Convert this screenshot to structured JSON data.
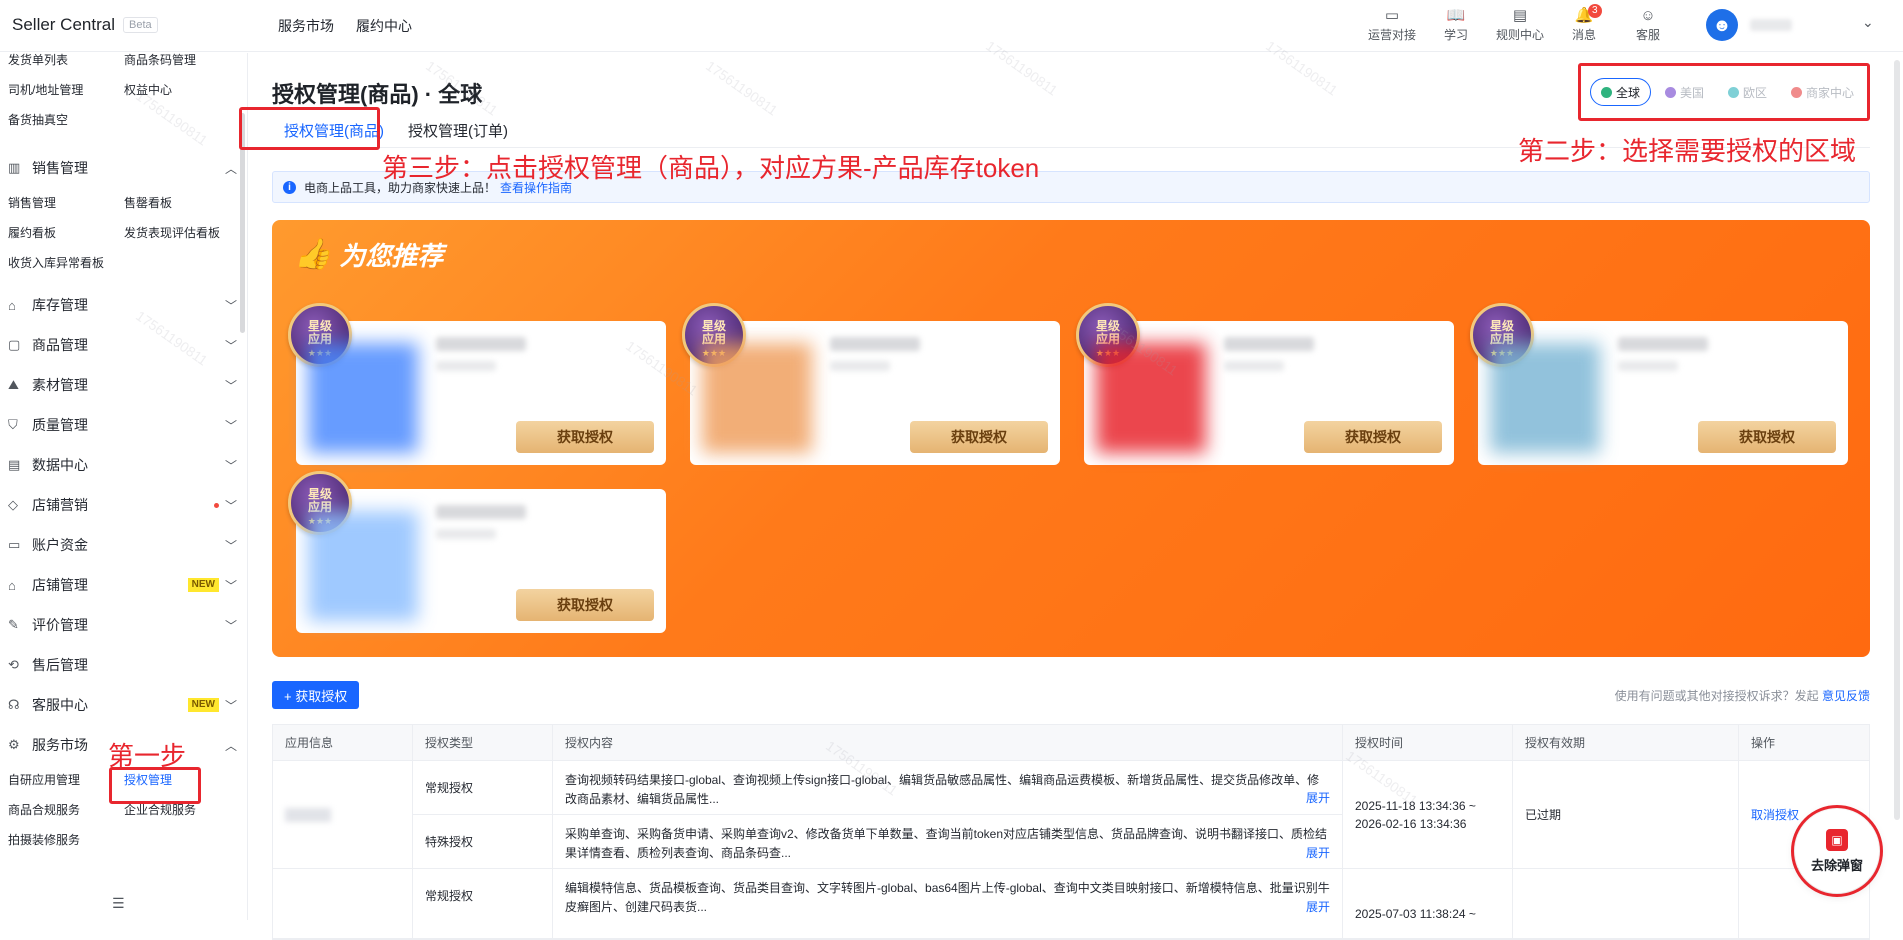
{
  "brand": {
    "name": "Seller Central",
    "beta": "Beta"
  },
  "top_nav": [
    "服务市场",
    "履约中心"
  ],
  "top_icons": [
    {
      "icon": "chat-icon",
      "label": "运营对接"
    },
    {
      "icon": "book-icon",
      "label": "学习"
    },
    {
      "icon": "doc-icon",
      "label": "规则中心"
    },
    {
      "icon": "bell-icon",
      "label": "消息",
      "badge": "3"
    },
    {
      "icon": "support-icon",
      "label": "客服"
    }
  ],
  "sidebar": {
    "top_items": [
      "发货单列表",
      "商品条码管理",
      "司机/地址管理",
      "权益中心",
      "备货抽真空"
    ],
    "sections": [
      {
        "label": "销售管理",
        "icon": "chart-icon",
        "expanded": true,
        "items": [
          "销售管理",
          "售罄看板",
          "履约看板",
          "发货表现评估看板",
          "收货入库异常看板"
        ]
      },
      {
        "label": "库存管理",
        "icon": "warehouse-icon"
      },
      {
        "label": "商品管理",
        "icon": "box-icon"
      },
      {
        "label": "素材管理",
        "icon": "image-icon"
      },
      {
        "label": "质量管理",
        "icon": "shield-icon"
      },
      {
        "label": "数据中心",
        "icon": "data-icon"
      },
      {
        "label": "店铺营销",
        "icon": "tag-icon",
        "dot": true
      },
      {
        "label": "账户资金",
        "icon": "wallet-icon"
      },
      {
        "label": "店铺管理",
        "icon": "store-icon",
        "new": "NEW"
      },
      {
        "label": "评价管理",
        "icon": "review-icon"
      },
      {
        "label": "售后管理",
        "icon": "aftersale-icon"
      },
      {
        "label": "客服中心",
        "icon": "headset-icon",
        "new": "NEW"
      },
      {
        "label": "服务市场",
        "icon": "market-icon",
        "expanded": true,
        "items": [
          "自研应用管理",
          "授权管理",
          "商品合规服务",
          "企业合规服务",
          "拍摄装修服务"
        ]
      }
    ]
  },
  "page": {
    "title": "授权管理(商品) · 全球",
    "tabs": [
      "授权管理(商品)",
      "授权管理(订单)"
    ],
    "regions": [
      {
        "label": "全球",
        "color": "#2fb37f",
        "active": true
      },
      {
        "label": "美国",
        "color": "#a88be0"
      },
      {
        "label": "欧区",
        "color": "#7fd0d6"
      },
      {
        "label": "商家中心",
        "color": "#f08b8b"
      }
    ],
    "info": {
      "text": "电商上品工具，助力商家快速上品！",
      "link": "查看操作指南"
    },
    "promo": {
      "title": "为您推荐",
      "medal_line1": "星级",
      "medal_line2": "应用",
      "button": "获取授权",
      "card_colors": [
        "#4d8bff",
        "#f0a060",
        "#e8262e",
        "#7fb8d6",
        "#8fc0ff"
      ]
    },
    "get_auth_button": "+ 获取授权",
    "feedback": {
      "text": "使用有问题或其他对接授权诉求？发起",
      "link": "意见反馈"
    },
    "table": {
      "headers": [
        "应用信息",
        "授权类型",
        "授权内容",
        "授权时间",
        "授权有效期",
        "操作"
      ],
      "rows": [
        {
          "types": [
            "常规授权",
            "特殊授权"
          ],
          "contents": [
            "查询视频转码结果接口-global、查询视频上传sign接口-global、编辑货品敏感品属性、编辑商品运费模板、新增货品属性、提交货品修改单、修改商品素材、编辑货品属性...",
            "采购单查询、采购备货申请、采购单查询v2、修改备货单下单数量、查询当前token对应店铺类型信息、货品品牌查询、说明书翻译接口、质检结果详情查看、质检列表查询、商品条码查..."
          ],
          "expand": "展开",
          "time": "2025-11-18 13:34:36 ~ 2026-02-16 13:34:36",
          "validity": "已过期",
          "action": "取消授权"
        },
        {
          "types": [
            "常规授权"
          ],
          "contents": [
            "编辑模特信息、货品模板查询、货品类目查询、文字转图片-global、bas64图片上传-global、查询中文类目映射接口、新增模特信息、批量识别牛皮癣图片、创建尺码表货..."
          ],
          "expand": "展开",
          "time": "2025-07-03 11:38:24 ~",
          "validity": "",
          "action": ""
        }
      ]
    }
  },
  "annotations": {
    "step1": "第一步",
    "step2": "第二步：选择需要授权的区域",
    "step3": "第三步：点击授权管理（商品），对应方果-产品库存token"
  },
  "popup": {
    "label": "去除弹窗"
  },
  "watermark": "17561190811"
}
